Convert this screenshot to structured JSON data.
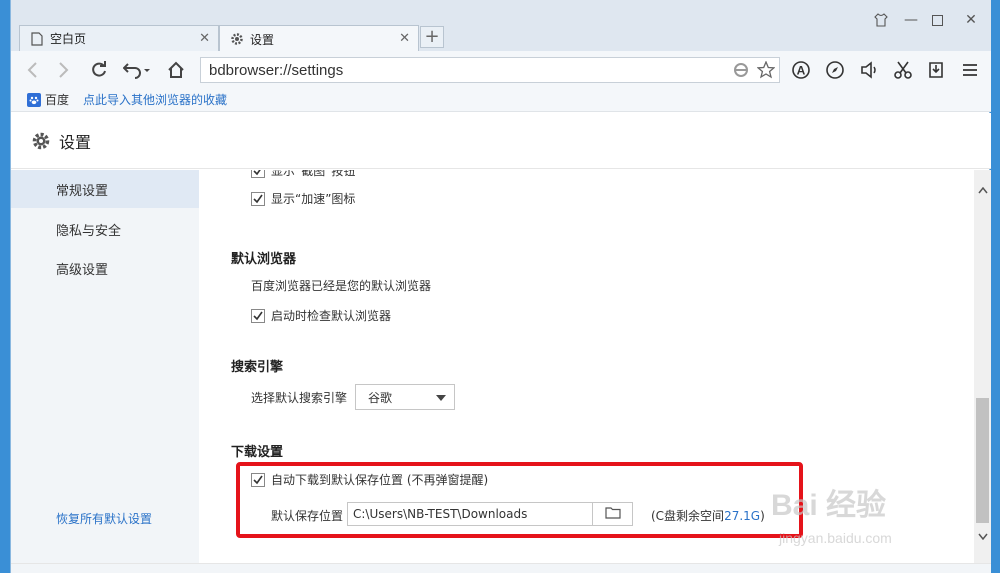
{
  "tabs": [
    {
      "label": "空白页",
      "icon": "document-icon"
    },
    {
      "label": "设置",
      "icon": "gear-icon"
    }
  ],
  "window_controls": [
    "skin-icon",
    "minimize-icon",
    "maximize-icon",
    "close-icon"
  ],
  "address": {
    "url": "bdbrowser://settings"
  },
  "bookmarks": {
    "baidu": "百度",
    "import_link": "点此导入其他浏览器的收藏"
  },
  "settings": {
    "title": "设置"
  },
  "sidebar": {
    "items": [
      {
        "label": "常规设置",
        "active": true
      },
      {
        "label": "隐私与安全",
        "active": false
      },
      {
        "label": "高级设置",
        "active": false
      }
    ],
    "restore": "恢复所有默认设置"
  },
  "content": {
    "partial_row": "显示“截图”按钮",
    "accel_row": "显示“加速”图标",
    "default_browser": {
      "title": "默认浏览器",
      "status": "百度浏览器已经是您的默认浏览器",
      "check_on_start": "启动时检查默认浏览器"
    },
    "search": {
      "title": "搜索引擎",
      "label": "选择默认搜索引擎",
      "selected": "谷歌"
    },
    "download": {
      "title": "下载设置",
      "auto_download": "自动下载到默认保存位置 (不再弹窗提醒)",
      "location_label": "默认保存位置",
      "path": "C:\\Users\\NB-TEST\\Downloads",
      "space_prefix": "(C盘剩余空间",
      "space_value": "27.1G",
      "space_suffix": ")"
    }
  },
  "watermark": {
    "logo": "Bai 经验",
    "sub": "jingyan.baidu.com"
  },
  "colors": {
    "link": "#2a72c8",
    "highlight": "#e5131a",
    "sidebar_active": "#e0e9f4"
  }
}
